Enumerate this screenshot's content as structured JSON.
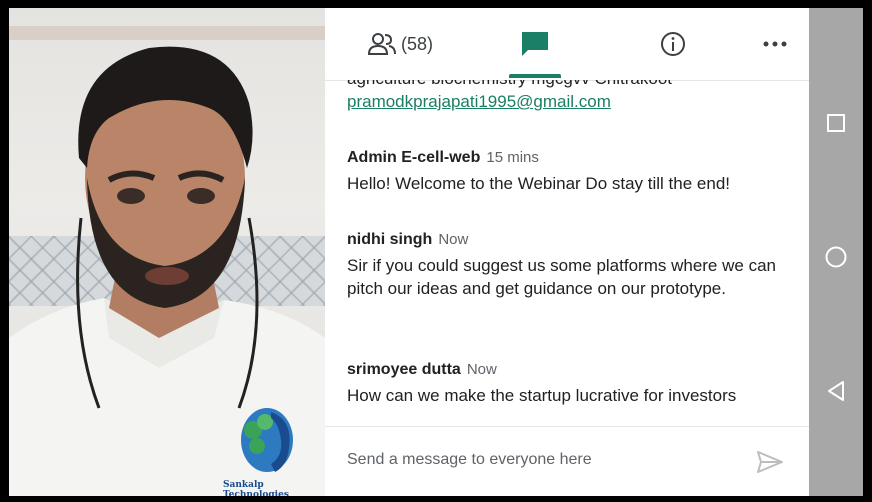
{
  "video": {
    "shirt_logo_text": "Sankalp Technologies"
  },
  "tabs": {
    "people_count": "(58)",
    "active_tab": "chat"
  },
  "messages": {
    "partial_top_line": "agriculture biochemistry mgcgvv Chitrakoot",
    "partial_email": "pramodkprajapati1995@gmail.com",
    "items": [
      {
        "sender": "Admin E-cell-web",
        "time": "15 mins",
        "text": "Hello! Welcome to the Webinar Do stay till the end!"
      },
      {
        "sender": "nidhi singh",
        "time": "Now",
        "text": "Sir if you could suggest us some platforms where we can pitch our ideas and get guidance on our prototype."
      },
      {
        "sender": "srimoyee dutta",
        "time": "Now",
        "text": "How can we make the startup lucrative for investors"
      }
    ]
  },
  "composer": {
    "placeholder": "Send a message to everyone here"
  },
  "colors": {
    "accent": "#1a7f64",
    "navbar": "#a7a7a7"
  },
  "icons": {
    "people": "people-icon",
    "chat": "chat-icon",
    "info": "info-icon",
    "more": "more-icon",
    "send": "send-icon",
    "recents": "square-icon",
    "home": "circle-icon",
    "back": "triangle-back-icon"
  }
}
